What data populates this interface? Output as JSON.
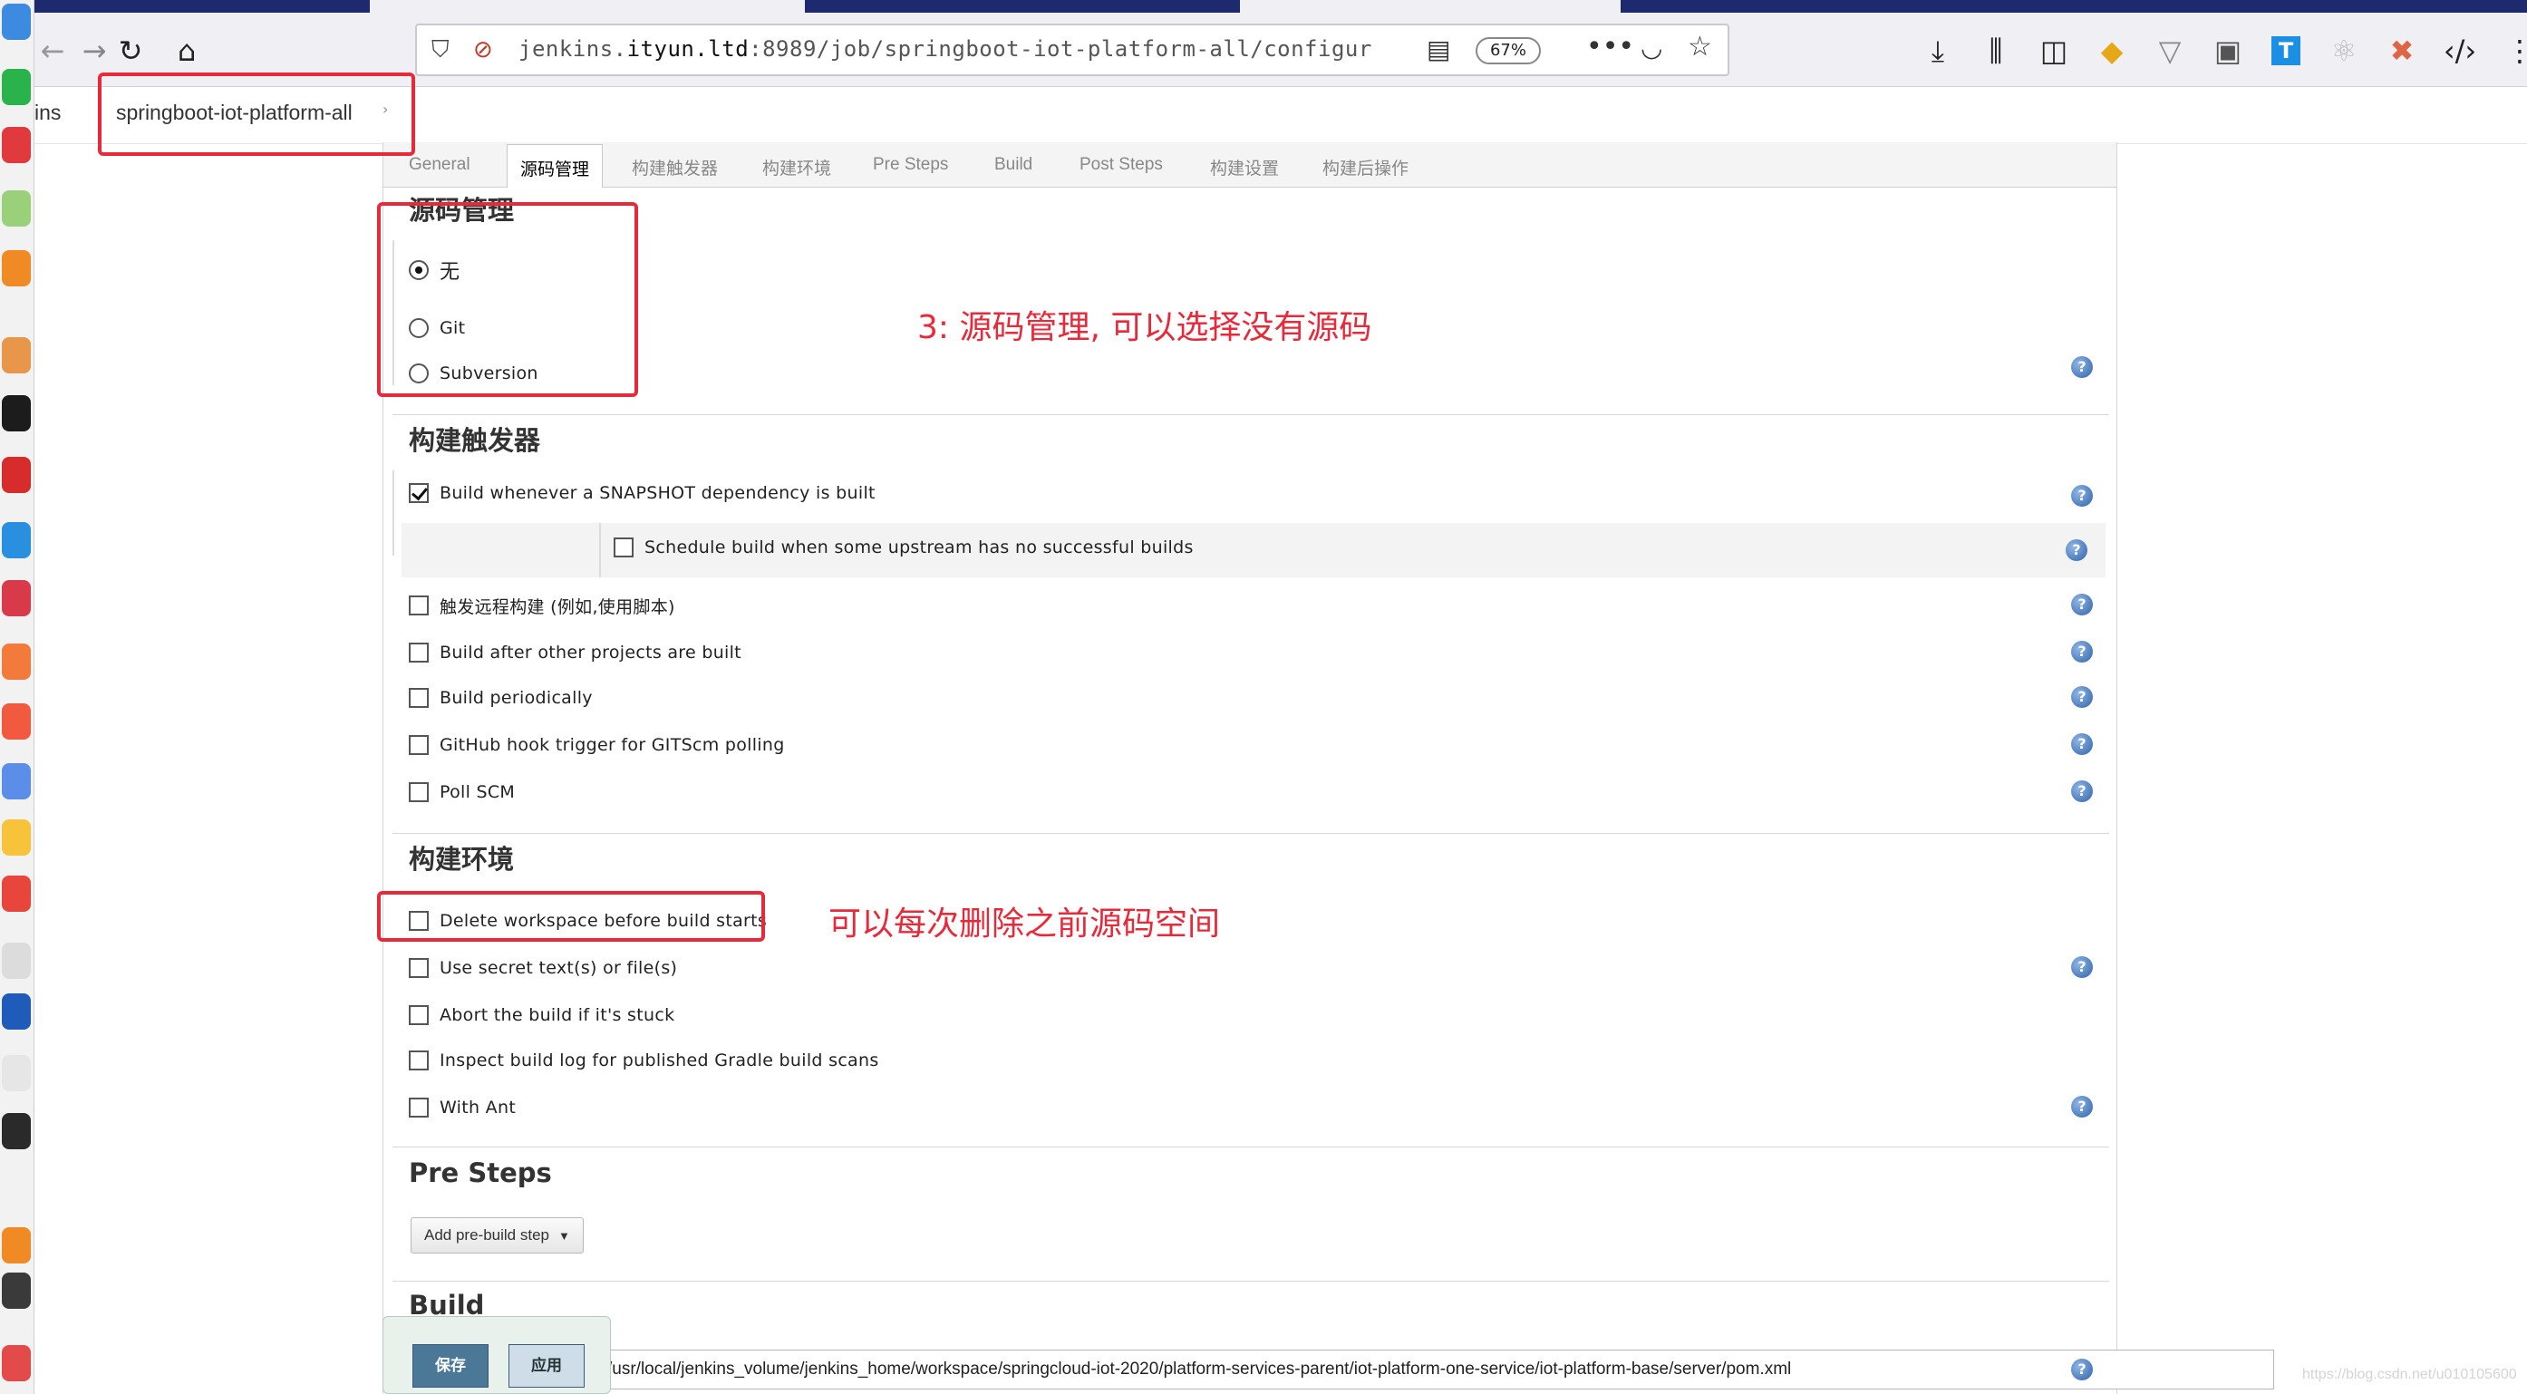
{
  "browser": {
    "url_prefix": "jenkins.",
    "url_host": "ityun.ltd",
    "url_rest": ":8989/job/springboot-iot-platform-all/configur",
    "zoom": "67%"
  },
  "breadcrumb": {
    "root": "ins",
    "job": "springboot-iot-platform-all",
    "arrow": "›"
  },
  "tabs": [
    {
      "label": "General"
    },
    {
      "label": "源码管理"
    },
    {
      "label": "构建触发器"
    },
    {
      "label": "构建环境"
    },
    {
      "label": "Pre Steps"
    },
    {
      "label": "Build"
    },
    {
      "label": "Post Steps"
    },
    {
      "label": "构建设置"
    },
    {
      "label": "构建后操作"
    }
  ],
  "scm": {
    "title": "源码管理",
    "options": [
      {
        "label": "无",
        "checked": true
      },
      {
        "label": "Git",
        "checked": false
      },
      {
        "label": "Subversion",
        "checked": false
      }
    ]
  },
  "triggers": {
    "title": "构建触发器",
    "items": [
      {
        "label": "Build whenever a SNAPSHOT dependency is built",
        "checked": true
      },
      {
        "label": "Schedule build when some upstream has no successful builds",
        "checked": false
      },
      {
        "label": "触发远程构建 (例如,使用脚本)",
        "checked": false
      },
      {
        "label": "Build after other projects are built",
        "checked": false
      },
      {
        "label": "Build periodically",
        "checked": false
      },
      {
        "label": "GitHub hook trigger for GITScm polling",
        "checked": false
      },
      {
        "label": "Poll SCM",
        "checked": false
      }
    ]
  },
  "build_env": {
    "title": "构建环境",
    "items": [
      {
        "label": "Delete workspace before build starts",
        "checked": false
      },
      {
        "label": "Use secret text(s) or file(s)",
        "checked": false
      },
      {
        "label": "Abort the build if it's stuck",
        "checked": false
      },
      {
        "label": "Inspect build log for published Gradle build scans",
        "checked": false
      },
      {
        "label": "With Ant",
        "checked": false
      }
    ]
  },
  "pre_steps": {
    "title": "Pre Steps",
    "add_button": "Add pre-build step"
  },
  "build": {
    "title": "Build",
    "pom_path": "/usr/local/jenkins_volume/jenkins_home/workspace/springcloud-iot-2020/platform-services-parent/iot-platform-one-service/iot-platform-base/server/pom.xml"
  },
  "actions": {
    "save": "保存",
    "apply": "应用"
  },
  "annotations": {
    "scm_note": "3: 源码管理, 可以选择没有源码",
    "workspace_note": "可以每次删除之前源码空间"
  },
  "help_glyph": "?",
  "watermark": "https://blog.csdn.net/u010105600",
  "colors": {
    "annotation_red": "#e8293a",
    "save_button": "#4b7897",
    "tabstrip": "#1e2a6e"
  }
}
